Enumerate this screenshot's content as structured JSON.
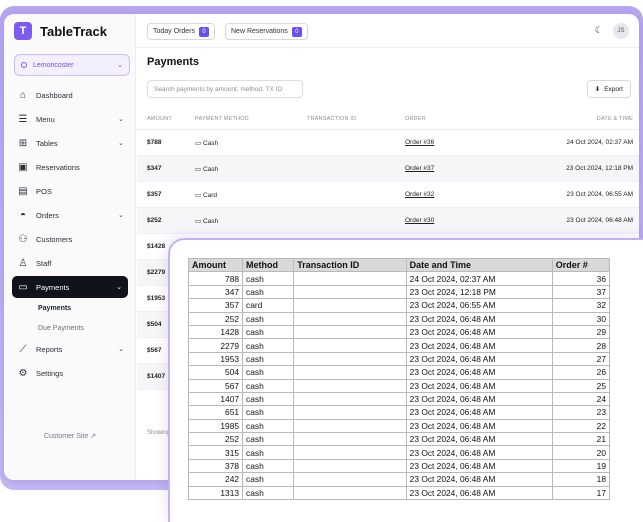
{
  "app": {
    "name": "TableTrack",
    "logo_letter": "T"
  },
  "sidebar": {
    "location": "Lemoncoster",
    "items": [
      {
        "label": "Dashboard",
        "icon": "home-icon",
        "chevron": false
      },
      {
        "label": "Menu",
        "icon": "menu-book-icon",
        "chevron": true
      },
      {
        "label": "Tables",
        "icon": "table-icon",
        "chevron": true
      },
      {
        "label": "Reservations",
        "icon": "calendar-icon",
        "chevron": false
      },
      {
        "label": "POS",
        "icon": "pos-icon",
        "chevron": false
      },
      {
        "label": "Orders",
        "icon": "cloche-icon",
        "chevron": true
      },
      {
        "label": "Customers",
        "icon": "users-icon",
        "chevron": false
      },
      {
        "label": "Staff",
        "icon": "user-icon",
        "chevron": false
      },
      {
        "label": "Payments",
        "icon": "wallet-icon",
        "chevron": true,
        "active": true
      },
      {
        "label": "Reports",
        "icon": "chart-icon",
        "chevron": true
      },
      {
        "label": "Settings",
        "icon": "gear-icon",
        "chevron": false
      }
    ],
    "payments_sub": [
      "Payments",
      "Due Payments"
    ],
    "customer_site": "Customer Site"
  },
  "topbar": {
    "today_orders": "Today Orders",
    "today_orders_count": "0",
    "new_reservations": "New Reservations",
    "new_reservations_count": "0",
    "avatar_initials": "JS"
  },
  "main": {
    "title": "Payments",
    "search_placeholder": "Search payments by amount, method, TX ID",
    "export_label": "Export",
    "columns": [
      "AMOUNT",
      "PAYMENT METHOD",
      "TRANSACTION ID",
      "ORDER",
      "DATE & TIME"
    ],
    "rows": [
      {
        "amount": "$788",
        "method": "Cash",
        "order": "Order #36",
        "date": "24 Oct 2024, 02:37 AM"
      },
      {
        "amount": "$347",
        "method": "Cash",
        "order": "Order #37",
        "date": "23 Oct 2024, 12:18 PM"
      },
      {
        "amount": "$357",
        "method": "Card",
        "order": "Order #32",
        "date": "23 Oct 2024, 06:55 AM"
      },
      {
        "amount": "$252",
        "method": "Cash",
        "order": "Order #30",
        "date": "23 Oct 2024, 06:48 AM"
      },
      {
        "amount": "$1428"
      },
      {
        "amount": "$2279"
      },
      {
        "amount": "$1953"
      },
      {
        "amount": "$504"
      },
      {
        "amount": "$567"
      },
      {
        "amount": "$1407"
      }
    ],
    "footer_note": "Showing"
  },
  "sheet": {
    "headers": [
      "Amount",
      "Method",
      "Transaction ID",
      "Date and Time",
      "Order #"
    ],
    "rows": [
      [
        "788",
        "cash",
        "",
        "24 Oct 2024, 02:37 AM",
        "36"
      ],
      [
        "347",
        "cash",
        "",
        "23 Oct 2024, 12:18 PM",
        "37"
      ],
      [
        "357",
        "card",
        "",
        "23 Oct 2024, 06:55 AM",
        "32"
      ],
      [
        "252",
        "cash",
        "",
        "23 Oct 2024, 06:48 AM",
        "30"
      ],
      [
        "1428",
        "cash",
        "",
        "23 Oct 2024, 06:48 AM",
        "29"
      ],
      [
        "2279",
        "cash",
        "",
        "23 Oct 2024, 06:48 AM",
        "28"
      ],
      [
        "1953",
        "cash",
        "",
        "23 Oct 2024, 06:48 AM",
        "27"
      ],
      [
        "504",
        "cash",
        "",
        "23 Oct 2024, 06:48 AM",
        "26"
      ],
      [
        "567",
        "cash",
        "",
        "23 Oct 2024, 06:48 AM",
        "25"
      ],
      [
        "1407",
        "cash",
        "",
        "23 Oct 2024, 06:48 AM",
        "24"
      ],
      [
        "651",
        "cash",
        "",
        "23 Oct 2024, 06:48 AM",
        "23"
      ],
      [
        "1985",
        "cash",
        "",
        "23 Oct 2024, 06:48 AM",
        "22"
      ],
      [
        "252",
        "cash",
        "",
        "23 Oct 2024, 06:48 AM",
        "21"
      ],
      [
        "315",
        "cash",
        "",
        "23 Oct 2024, 06:48 AM",
        "20"
      ],
      [
        "378",
        "cash",
        "",
        "23 Oct 2024, 06:48 AM",
        "19"
      ],
      [
        "242",
        "cash",
        "",
        "23 Oct 2024, 06:48 AM",
        "18"
      ],
      [
        "1313",
        "cash",
        "",
        "23 Oct 2024, 06:48 AM",
        "17"
      ]
    ]
  },
  "colors": {
    "accent": "#7c5cf0",
    "backdrop": "#c1b0f5",
    "active_nav": "#11131a"
  }
}
